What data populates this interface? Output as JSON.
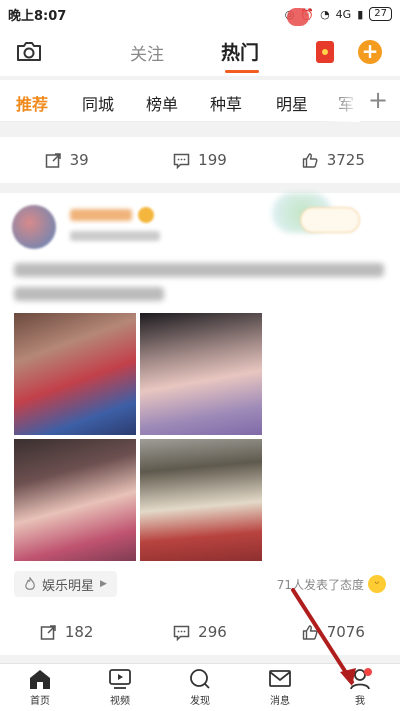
{
  "status_bar": {
    "time": "晚上8:07",
    "network": "4G",
    "battery": "27"
  },
  "header": {
    "tab_follow": "关注",
    "tab_hot": "热门"
  },
  "categories": [
    "推荐",
    "同城",
    "榜单",
    "种草",
    "明星",
    "军"
  ],
  "prev_post_actions": {
    "repost": "39",
    "comment": "199",
    "like": "3725"
  },
  "post": {
    "topic": "娱乐明星",
    "attitude_text": "71人发表了态度",
    "actions": {
      "repost": "182",
      "comment": "296",
      "like": "7076"
    }
  },
  "bottom_nav": [
    {
      "label": "首页",
      "icon": "home-icon"
    },
    {
      "label": "视频",
      "icon": "video-icon"
    },
    {
      "label": "发现",
      "icon": "discover-icon"
    },
    {
      "label": "消息",
      "icon": "message-icon"
    },
    {
      "label": "我",
      "icon": "profile-icon"
    }
  ],
  "colors": {
    "accent_orange": "#f08a1c",
    "hot_underline": "#f25c20",
    "annotation_arrow": "#b01d1d"
  }
}
